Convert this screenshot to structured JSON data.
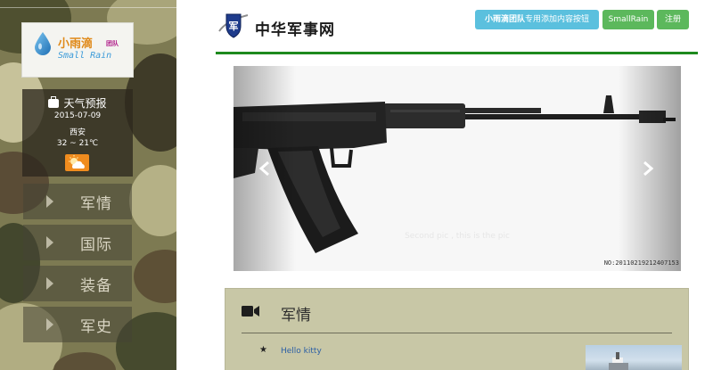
{
  "sidebar": {
    "logo": {
      "name_cn": "小雨滴",
      "tag": "团队",
      "name_en": "Small Rain"
    },
    "weather": {
      "title": "天气预报",
      "date": "2015-07-09",
      "city": "西安",
      "temp": "32 ~ 21℃",
      "icon": "sun-cloud-icon"
    },
    "nav": [
      {
        "label": "军情"
      },
      {
        "label": "国际"
      },
      {
        "label": "装备"
      },
      {
        "label": "军史"
      }
    ]
  },
  "header": {
    "site_name": "中华军事网",
    "emblem_text": "军",
    "buttons": {
      "info_bold": "小雨滴团队",
      "info_rest": "专用添加内容按钮",
      "small_rain": "SmallRain",
      "register": "注册"
    },
    "accent": "#1e8a1e"
  },
  "carousel": {
    "caption": "Second pic , this is the pic",
    "watermark": "NO:20110219212407153"
  },
  "panel": {
    "title": "军情",
    "items": [
      {
        "star": "★",
        "link": "Hello kitty"
      }
    ]
  }
}
